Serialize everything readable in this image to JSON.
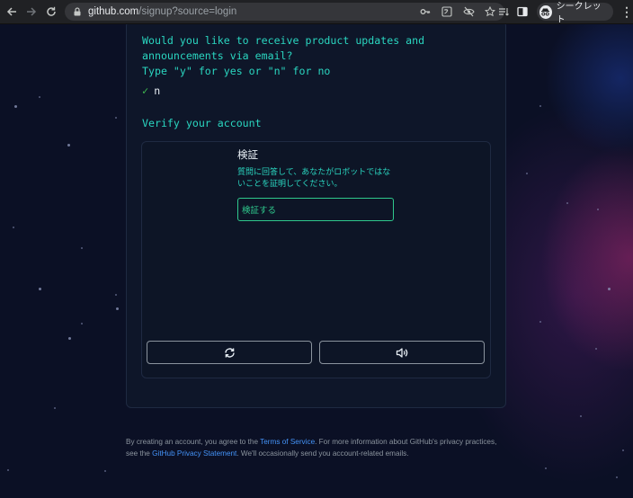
{
  "browser": {
    "url_host": "github.com",
    "url_path": "/signup?source=login",
    "profile_label": "シークレット"
  },
  "signup": {
    "question": "Would you like to receive product updates and\nannouncements via email?\nType \"y\" for yes or \"n\" for no",
    "answer_check": "✓",
    "answer_value": "n",
    "verify_heading": "Verify your account"
  },
  "captcha": {
    "title": "検証",
    "description": "質問に回答して、あなたがロボットではな いことを証明してください。",
    "verify_button": "検証する",
    "reload_icon": "refresh-icon",
    "audio_icon": "speaker-icon"
  },
  "footer": {
    "text_1": "By creating an account, you agree to the ",
    "terms_link": "Terms of Service",
    "text_2": ". For more information about GitHub's privacy practices, see the ",
    "privacy_link": "GitHub Privacy Statement",
    "text_3": ". We'll occasionally send you account-related emails."
  },
  "colors": {
    "accent_teal": "#2ad6c0",
    "button_green": "#2fc98d",
    "link_blue": "#4493f8",
    "background": "#0b1025"
  }
}
